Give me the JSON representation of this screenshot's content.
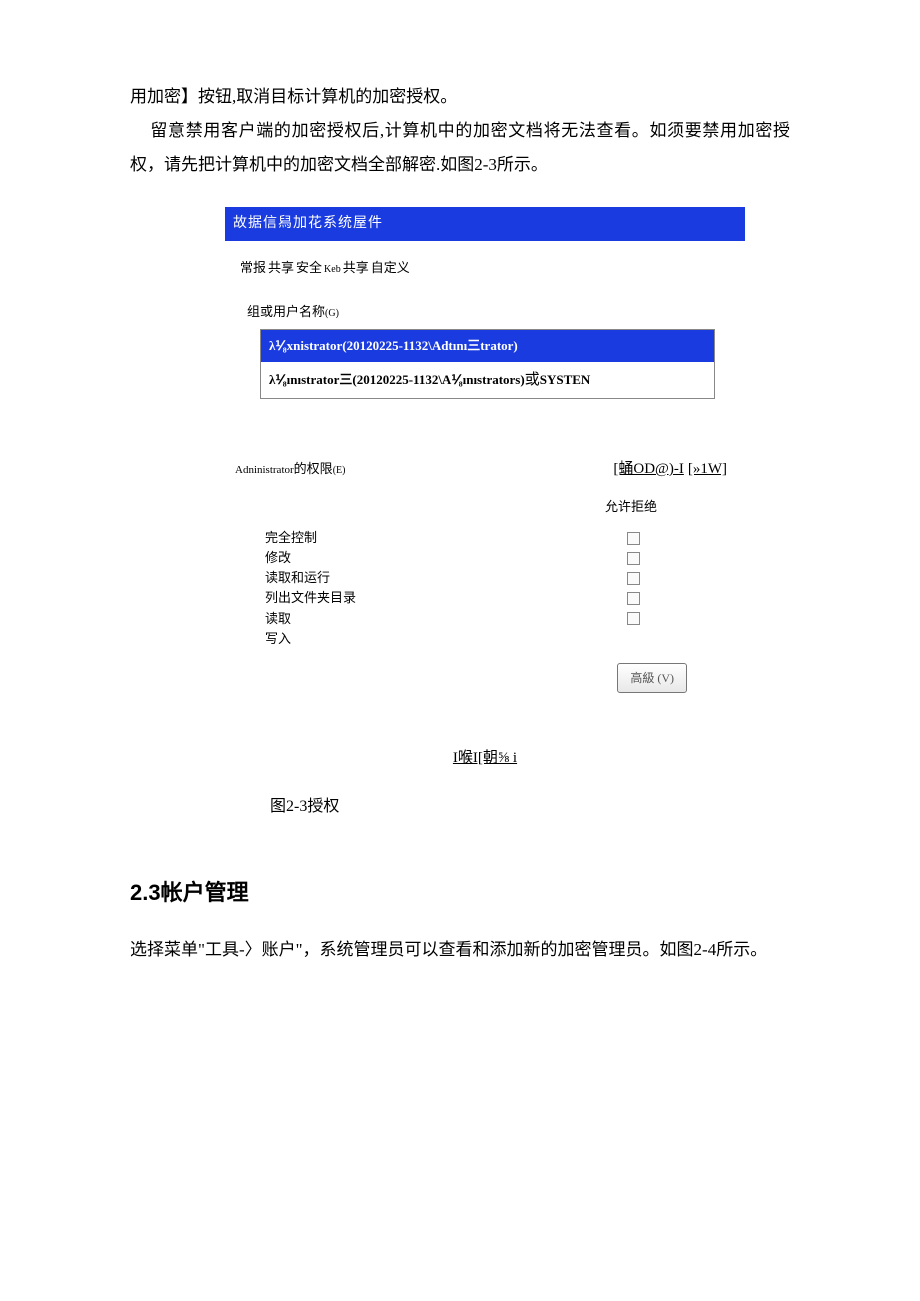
{
  "para1": "用加密】按钮,取消目标计算机的加密授权。",
  "para2": "留意禁用客户端的加密授权后,计算机中的加密文档将无法查看。如须要禁用加密授权，请先把计算机中的加密文档全部解密.如图2-3所示。",
  "dialog": {
    "title": "故据信舄加花系统屋件",
    "tabs": {
      "t1": "常报",
      "t2": "共享",
      "t3": "安全",
      "sub": "Keb",
      "t4": "共享",
      "t5": "自定义"
    },
    "group_label": "组或用户名称",
    "group_label_sub": "(G)",
    "users": [
      "λ⅟₈xnistrator(20120225-1132\\Adtını三trator)",
      "λ⅟₈ınıstrator三(20120225-1132\\A⅟₈ınıstrators)"
    ],
    "users_suffix_cjk": "或",
    "users_suffix_en": "SYSTEN",
    "top_btn1": "[蛹OD@)-I",
    "top_btn2": "[»1W]",
    "perm_label_en": "Adninistrator",
    "perm_label_cn": "的权限",
    "perm_label_sub": "(E)",
    "colhdr": "允许拒绝",
    "perms": [
      "完全控制",
      "修改",
      "读取和运行",
      "列出文件夹目录",
      "读取",
      "写入"
    ],
    "adv_btn": "高級 (V)",
    "bottom_line": "I喉I[朝⅝                         i"
  },
  "fig_caption": "图2-3授权",
  "section_title": "2.3帐户管理",
  "para3": "选择菜单\"工具-〉账户\"，系统管理员可以查看和添加新的加密管理员。如图2-4所示。"
}
